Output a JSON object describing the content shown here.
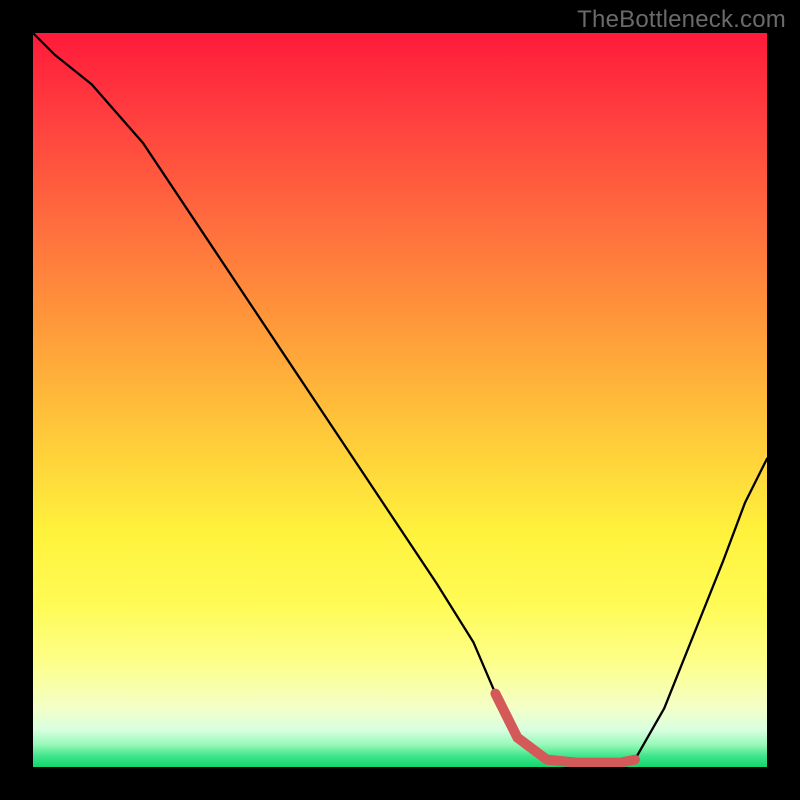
{
  "watermark": "TheBottleneck.com",
  "chart_data": {
    "type": "line",
    "title": "",
    "xlabel": "",
    "ylabel": "",
    "xlim": [
      0,
      100
    ],
    "ylim": [
      0,
      100
    ],
    "grid": false,
    "series": [
      {
        "name": "main-curve",
        "color": "#000000",
        "x": [
          0,
          3,
          8,
          15,
          25,
          35,
          45,
          55,
          60,
          63,
          66,
          70,
          74,
          77,
          80,
          82,
          86,
          90,
          94,
          97,
          100
        ],
        "values": [
          100,
          97,
          93,
          85,
          70,
          55,
          40,
          25,
          17,
          10,
          4,
          1,
          0.6,
          0.6,
          0.6,
          1,
          8,
          18,
          28,
          36,
          42
        ]
      },
      {
        "name": "highlight-segment",
        "color": "#d45a5a",
        "x": [
          63,
          66,
          70,
          74,
          77,
          80,
          82
        ],
        "values": [
          10,
          4,
          1,
          0.6,
          0.6,
          0.6,
          1
        ]
      }
    ],
    "gradient_background": {
      "orientation": "vertical",
      "stops": [
        {
          "pos": 0.0,
          "color": "#ff1a3a"
        },
        {
          "pos": 0.25,
          "color": "#ff6a3e"
        },
        {
          "pos": 0.55,
          "color": "#ffca3a"
        },
        {
          "pos": 0.78,
          "color": "#fffb56"
        },
        {
          "pos": 0.92,
          "color": "#f3ffc8"
        },
        {
          "pos": 0.97,
          "color": "#95f9b6"
        },
        {
          "pos": 1.0,
          "color": "#12d66e"
        }
      ]
    }
  }
}
